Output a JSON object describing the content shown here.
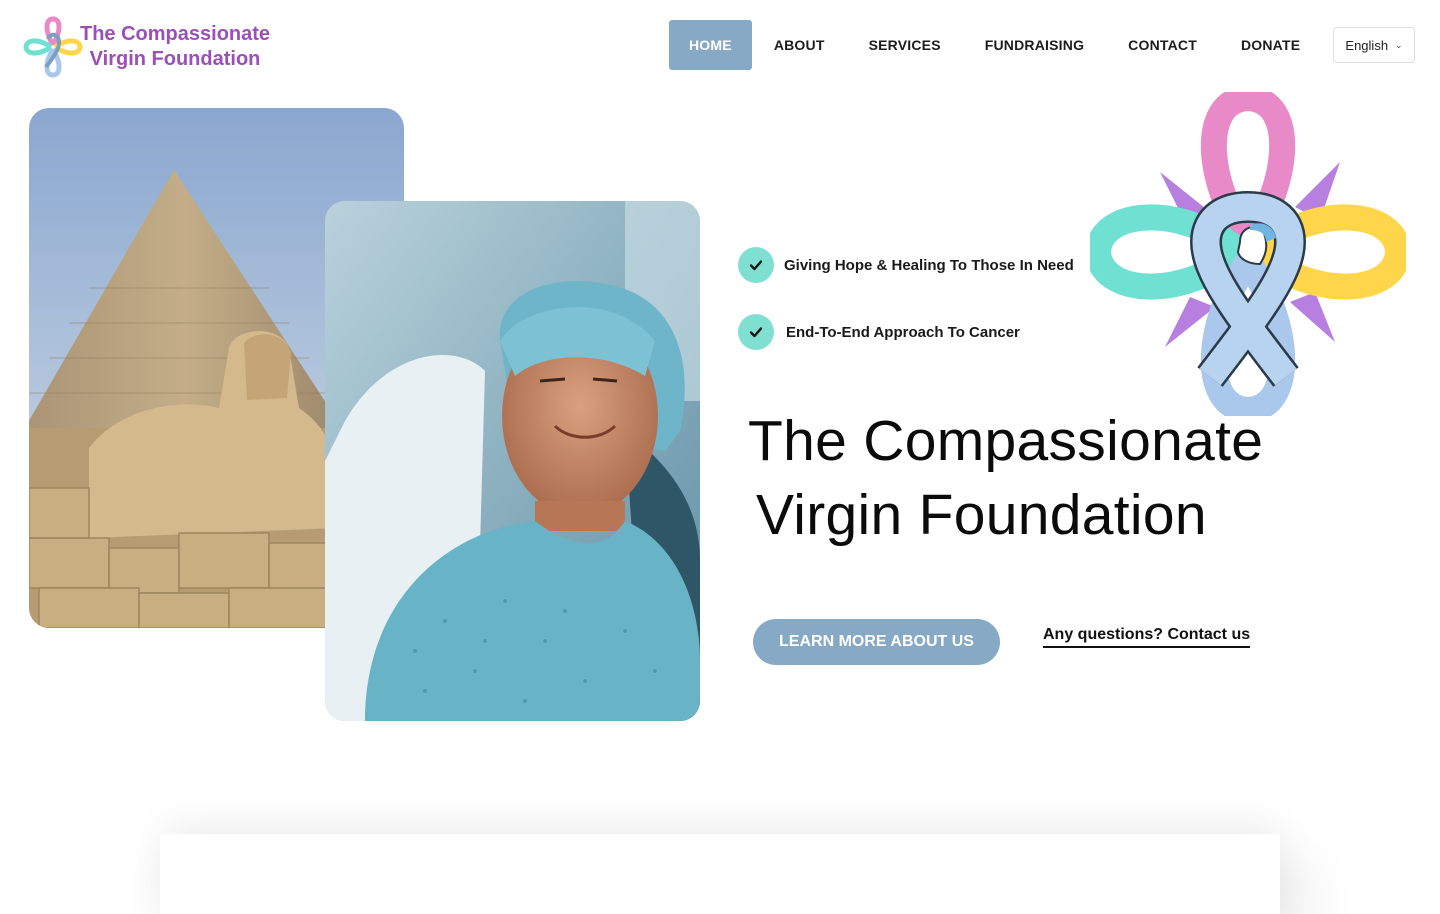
{
  "header": {
    "logo": {
      "line1": "The Compassionate",
      "line2": "Virgin Foundation",
      "icon": "ribbon-flower-icon"
    },
    "nav": [
      {
        "label": "HOME",
        "active": true
      },
      {
        "label": "ABOUT",
        "active": false
      },
      {
        "label": "SERVICES",
        "active": false
      },
      {
        "label": "FUNDRAISING",
        "active": false
      },
      {
        "label": "CONTACT",
        "active": false
      },
      {
        "label": "DONATE",
        "active": false
      }
    ],
    "language": {
      "selected": "English",
      "icon": "chevron-down-icon"
    }
  },
  "hero": {
    "features": [
      {
        "text": "Giving Hope & Healing To Those In Need",
        "icon": "check-icon"
      },
      {
        "text": "End-To-End Approach To Cancer",
        "icon": "check-icon"
      }
    ],
    "title_line1": "The Compassionate",
    "title_line2": "Virgin Foundation",
    "cta_label": "LEARN MORE ABOUT US",
    "contact_link": "Any questions? Contact us"
  },
  "colors": {
    "brand_purple": "#9b4fb8",
    "accent_blue": "#86a9c6",
    "check_teal": "#7fe0d2",
    "ribbon_pink": "#e88ac8",
    "ribbon_teal": "#6fe0d2",
    "ribbon_yellow": "#ffd54a",
    "ribbon_blue": "#a9c8ec",
    "ribbon_purple": "#b67fe0"
  }
}
